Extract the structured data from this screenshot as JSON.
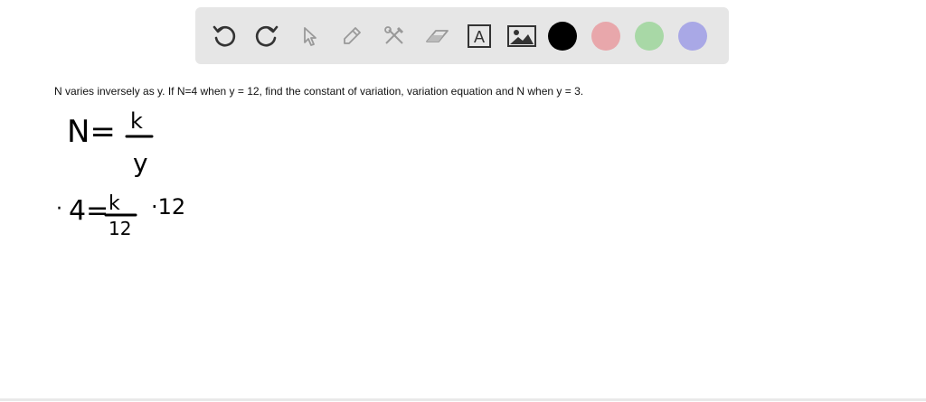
{
  "toolbar": {
    "tools": [
      {
        "name": "undo-icon"
      },
      {
        "name": "redo-icon"
      },
      {
        "name": "select-arrow-icon"
      },
      {
        "name": "pen-icon"
      },
      {
        "name": "tools-icon"
      },
      {
        "name": "eraser-icon"
      },
      {
        "name": "text-icon",
        "glyph": "A"
      },
      {
        "name": "image-icon"
      }
    ],
    "colors": [
      "#000000",
      "#e8a7ab",
      "#a8d8a6",
      "#a9a8e6"
    ]
  },
  "question": {
    "text": "N varies inversely as y. If N=4 when y = 12, find the constant of variation, variation equation and N when y = 3."
  },
  "handwriting": {
    "line1_lhs": "N=",
    "line1_num": "k",
    "line1_den": "y",
    "line2_dot": "·",
    "line2_lhs": "4=",
    "line2_num": "k",
    "line2_den": "12",
    "line2_mult": "·12"
  }
}
